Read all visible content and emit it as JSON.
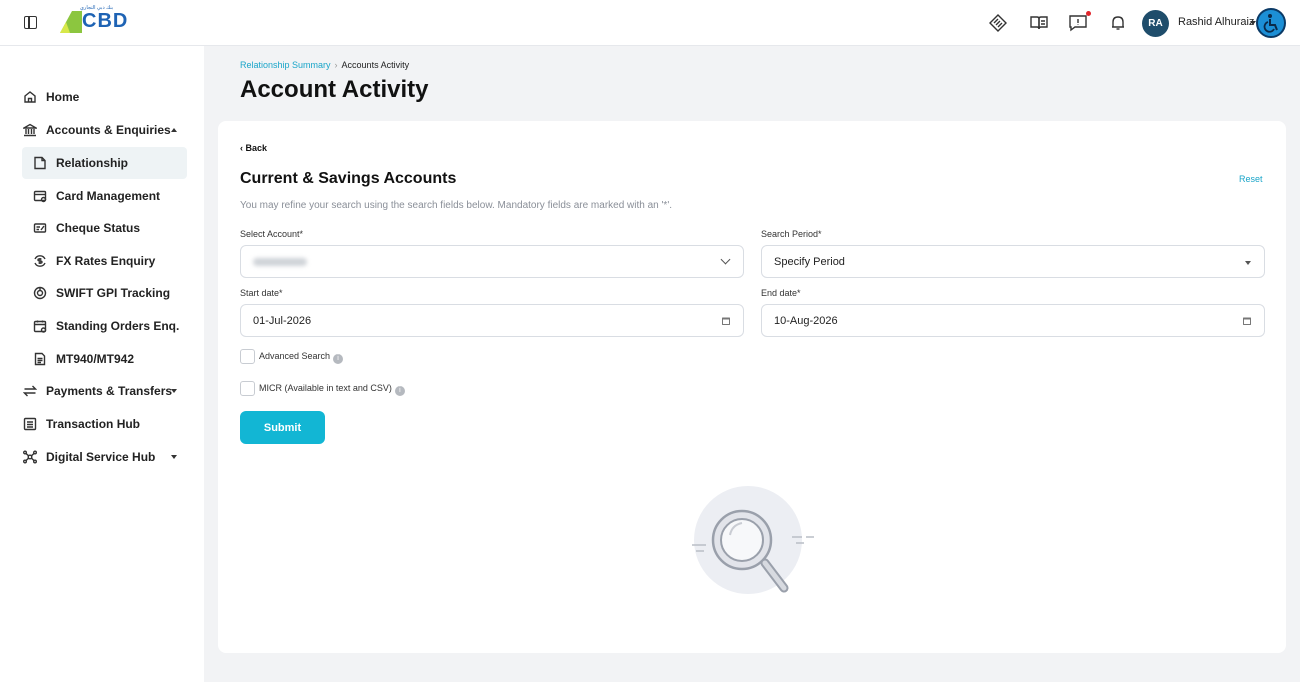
{
  "header": {
    "logo_text": "CBD",
    "logo_arabic": "بنك دبي التجاري",
    "user_initials": "RA",
    "user_name": "Rashid Alhuraiz",
    "icons": [
      "menu-toggle-icon",
      "tag-icon",
      "book-icon",
      "feedback-icon",
      "bell-icon",
      "accessibility-icon"
    ]
  },
  "sidebar": {
    "items": [
      {
        "label": "Home",
        "icon": "home-icon"
      },
      {
        "label": "Accounts & Enquiries",
        "icon": "bank-icon",
        "expanded": true
      },
      {
        "label": "Payments & Transfers",
        "icon": "transfer-icon"
      },
      {
        "label": "Transaction Hub",
        "icon": "list-icon"
      },
      {
        "label": "Digital Service Hub",
        "icon": "network-icon"
      }
    ],
    "subitems": [
      {
        "label": "Relationship",
        "icon": "document-icon",
        "active": true
      },
      {
        "label": "Card Management",
        "icon": "card-icon"
      },
      {
        "label": "Cheque Status",
        "icon": "cheque-icon"
      },
      {
        "label": "FX Rates Enquiry",
        "icon": "fx-icon"
      },
      {
        "label": "SWIFT GPI Tracking",
        "icon": "tracking-icon"
      },
      {
        "label": "Standing Orders Enq.",
        "icon": "calendar-icon"
      },
      {
        "label": "MT940/MT942",
        "icon": "file-icon"
      }
    ]
  },
  "breadcrumb": {
    "parent": "Relationship Summary",
    "separator": "›",
    "current": "Accounts Activity"
  },
  "page_title": "Account Activity",
  "form": {
    "back_label": "‹ Back",
    "title": "Current & Savings Accounts",
    "reset_label": "Reset",
    "description": "You may refine your search using the search fields below. Mandatory fields are marked with an '*'.",
    "select_account_label": "Select Account*",
    "search_period_label": "Search Period*",
    "search_period_value": "Specify Period",
    "start_date_label": "Start date*",
    "start_date_value": "01-Jul-2026",
    "end_date_label": "End date*",
    "end_date_value": "10-Aug-2026",
    "advanced_search_label": "Advanced Search",
    "micr_label": "MICR (Available in text and CSV)",
    "submit_label": "Submit"
  },
  "colors": {
    "accent": "#12b6d4",
    "link": "#1aa5c9",
    "brand_blue": "#1e63b4",
    "brand_green": "#8cc63f",
    "avatar": "#1f4d6b"
  }
}
